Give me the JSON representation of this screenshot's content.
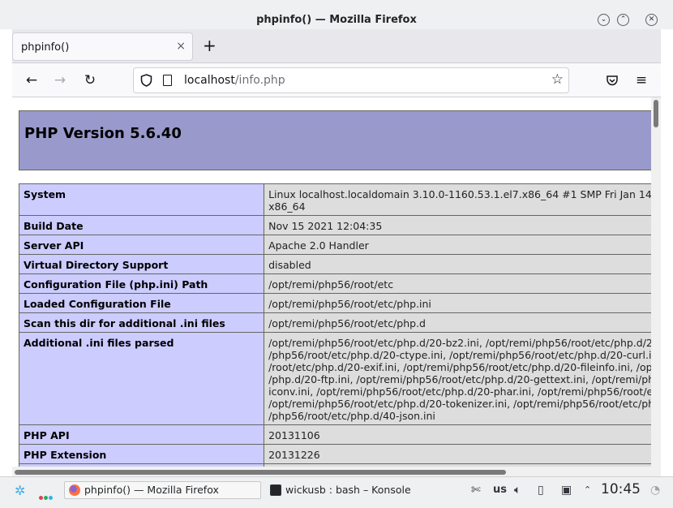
{
  "window": {
    "title": "phpinfo() — Mozilla Firefox",
    "buttons": {
      "minimize": "⌄",
      "maximize": "⌃",
      "close": "✕"
    }
  },
  "tabs": [
    {
      "label": "phpinfo()",
      "close": "×"
    }
  ],
  "newtab_label": "+",
  "nav": {
    "back": "←",
    "forward": "→",
    "reload": "↻",
    "url_host": "localhost",
    "url_path": "/info.php",
    "menu": "≡"
  },
  "page": {
    "heading": "PHP Version 5.6.40",
    "rows": [
      {
        "label": "System",
        "value": "Linux localhost.localdomain 3.10.0-1160.53.1.el7.x86_64 #1 SMP Fri Jan 14 1\nx86_64"
      },
      {
        "label": "Build Date",
        "value": "Nov 15 2021 12:04:35"
      },
      {
        "label": "Server API",
        "value": "Apache 2.0 Handler"
      },
      {
        "label": "Virtual Directory Support",
        "value": "disabled"
      },
      {
        "label": "Configuration File (php.ini) Path",
        "value": "/opt/remi/php56/root/etc"
      },
      {
        "label": "Loaded Configuration File",
        "value": "/opt/remi/php56/root/etc/php.ini"
      },
      {
        "label": "Scan this dir for additional .ini files",
        "value": "/opt/remi/php56/root/etc/php.d"
      },
      {
        "label": "Additional .ini files parsed",
        "value": "/opt/remi/php56/root/etc/php.d/20-bz2.ini, /opt/remi/php56/root/etc/php.d/20\n/php56/root/etc/php.d/20-ctype.ini, /opt/remi/php56/root/etc/php.d/20-curl.ini\n/root/etc/php.d/20-exif.ini, /opt/remi/php56/root/etc/php.d/20-fileinfo.ini, /opt/\n/php.d/20-ftp.ini, /opt/remi/php56/root/etc/php.d/20-gettext.ini, /opt/remi/php\niconv.ini, /opt/remi/php56/root/etc/php.d/20-phar.ini, /opt/remi/php56/root/etc\n/opt/remi/php56/root/etc/php.d/20-tokenizer.ini, /opt/remi/php56/root/etc/php\n/php56/root/etc/php.d/40-json.ini"
      },
      {
        "label": "PHP API",
        "value": "20131106"
      },
      {
        "label": "PHP Extension",
        "value": "20131226"
      },
      {
        "label": "",
        "value": ""
      }
    ]
  },
  "taskbar": {
    "tasks": [
      {
        "label": "phpinfo() — Mozilla Firefox",
        "active": true
      },
      {
        "label": "wickusb : bash – Konsole",
        "active": false
      }
    ],
    "keyboard_layout": "us",
    "clock": "10:45"
  },
  "colors": {
    "php_header": "#9999cc",
    "label_cell": "#ccccff",
    "value_cell": "#dddddd",
    "accent": "#3daee9"
  }
}
